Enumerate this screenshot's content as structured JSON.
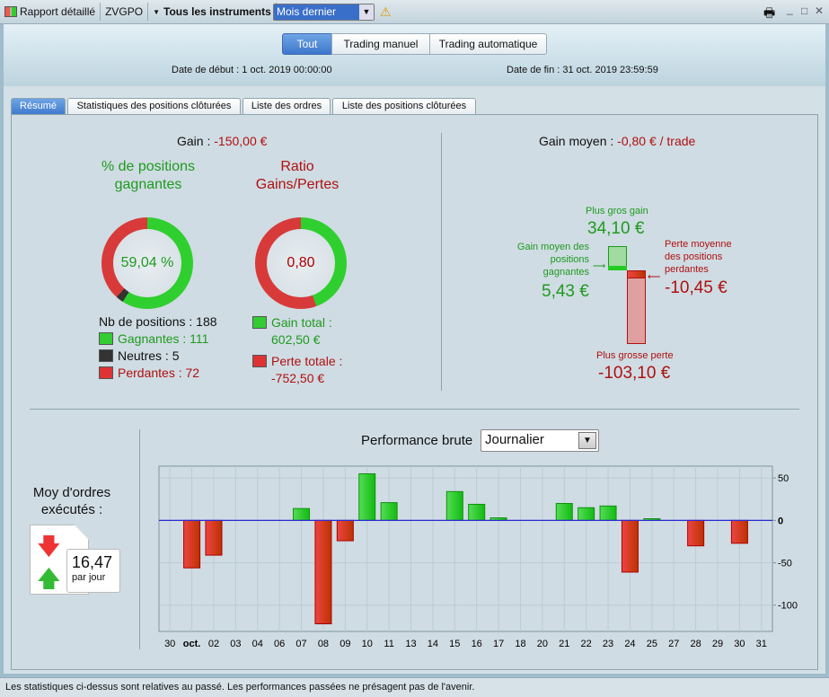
{
  "toolbar": {
    "report": "Rapport détaillé",
    "account": "ZVGPO",
    "instruments": "Tous les instruments",
    "period": "Mois dernier"
  },
  "filters": [
    {
      "label": "Tout",
      "selected": true
    },
    {
      "label": "Trading manuel"
    },
    {
      "label": "Trading automatique"
    }
  ],
  "dates": {
    "start_label": "Date de début :",
    "start": "1 oct. 2019 00:00:00",
    "end_label": "Date de fin :",
    "end": "31 oct. 2019 23:59:59"
  },
  "tabs": [
    {
      "label": "Résumé",
      "selected": true
    },
    {
      "label": "Statistiques des positions clôturées"
    },
    {
      "label": "Liste des ordres"
    },
    {
      "label": "Liste des positions clôturées"
    }
  ],
  "summary": {
    "gain_label": "Gain :",
    "gain": "-150,00 €",
    "win_title": "% de positions gagnantes",
    "win_pct": "59,04 %",
    "win_fraction": 0.5904,
    "neutral_fraction": 0.0266,
    "ratio_title": "Ratio Gains/Pertes",
    "ratio": "0,80",
    "ratio_gain_fraction": 0.445,
    "nb_positions": "Nb de positions : 188",
    "winners": "Gagnantes : 111",
    "neutral": "Neutres : 5",
    "losers": "Perdantes : 72",
    "total_gain_label": "Gain total :",
    "total_gain": "602,50 €",
    "total_loss_label": "Perte totale :",
    "total_loss": "-752,50 €",
    "avg_gain_label": "Gain moyen :",
    "avg_gain": "-0,80 € / trade",
    "biggest_gain_label": "Plus gros gain",
    "biggest_gain": "34,10 €",
    "avg_win_label": "Gain moyen des positions gagnantes",
    "avg_win": "5,43 €",
    "avg_loss_label": "Perte moyenne des positions perdantes",
    "avg_loss": "-10,45 €",
    "biggest_loss_label": "Plus grosse perte",
    "biggest_loss": "-103,10 €"
  },
  "orders": {
    "label": "Moy d'ordres exécutés :",
    "value": "16,47",
    "unit": "par jour"
  },
  "performance": {
    "label": "Performance brute",
    "mode": "Journalier"
  },
  "chart_data": {
    "type": "bar",
    "title": "Performance brute",
    "categories": [
      "30",
      "oct.",
      "02",
      "03",
      "04",
      "06",
      "07",
      "08",
      "09",
      "10",
      "11",
      "13",
      "14",
      "15",
      "16",
      "17",
      "18",
      "20",
      "21",
      "22",
      "23",
      "24",
      "25",
      "27",
      "28",
      "29",
      "30",
      "31"
    ],
    "values": [
      0,
      -56,
      -41,
      0,
      0,
      0,
      14,
      -122,
      -24,
      55,
      21,
      0,
      0,
      34,
      19,
      3,
      0,
      0,
      20,
      15,
      17,
      -61,
      2,
      0,
      -30,
      0,
      -27,
      0
    ],
    "ylim": [
      -131,
      64
    ],
    "yticks": [
      50,
      0,
      -50,
      -100
    ],
    "ytick_labels": [
      "50",
      "0",
      "-50",
      "-100"
    ],
    "grid": true
  },
  "status": "Les statistiques ci-dessus sont relatives au passé. Les performances passées ne présagent pas de l'avenir."
}
